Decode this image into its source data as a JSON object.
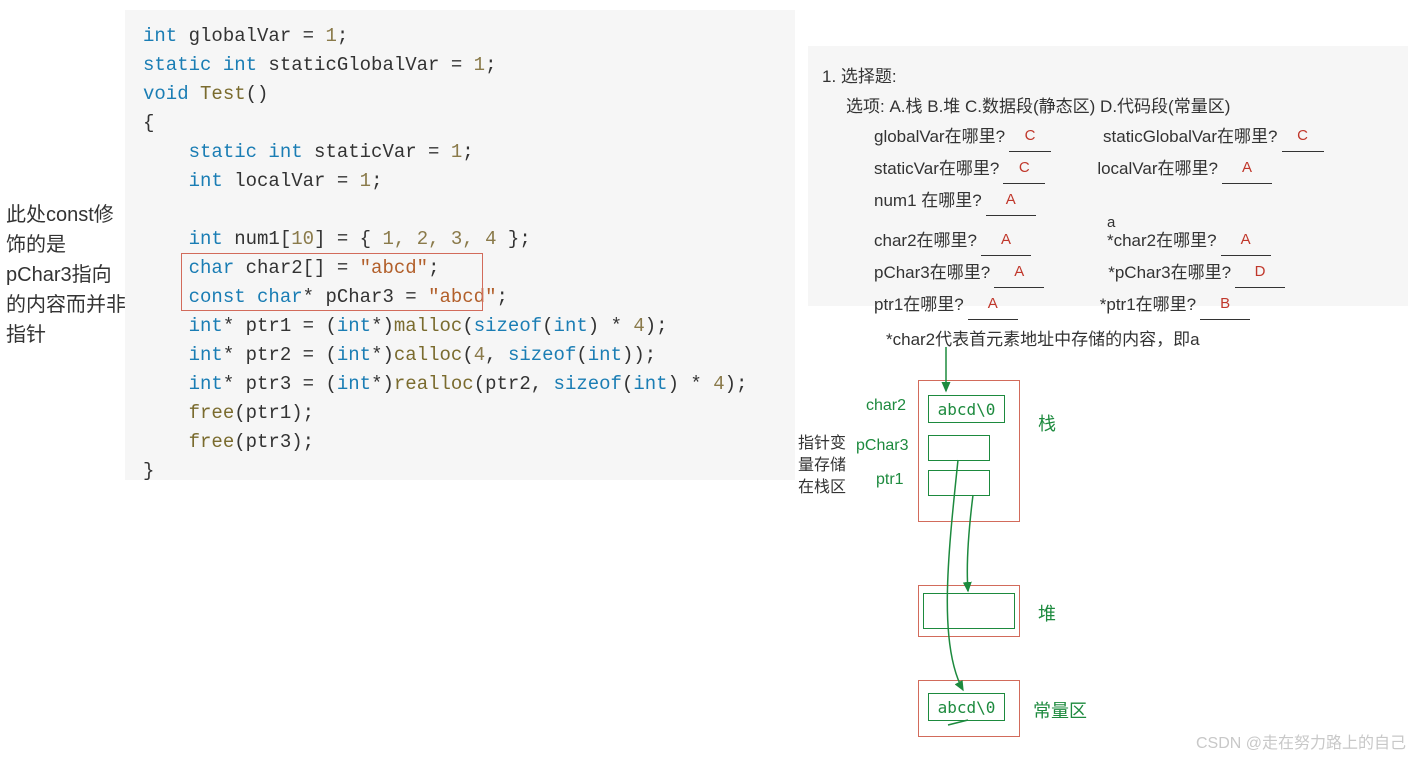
{
  "annotation": "此处const修饰的是pChar3指向的内容而并非指针",
  "code": {
    "l1_kw1": "int",
    "l1_rest": " globalVar = ",
    "l1_num": "1",
    "l1_end": ";",
    "l2_kw1": "static int",
    "l2_rest": " staticGlobalVar = ",
    "l2_num": "1",
    "l2_end": ";",
    "l3_kw1": "void",
    "l3_sp": " ",
    "l3_fn": "Test",
    "l3_end": "()",
    "l4": "{",
    "l5_kw": "static int",
    "l5_rest": " staticVar = ",
    "l5_num": "1",
    "l5_end": ";",
    "l6_kw": "int",
    "l6_rest": " localVar = ",
    "l6_num": "1",
    "l6_end": ";",
    "l8_kw": "int",
    "l8_rest": " num1[",
    "l8_num10": "10",
    "l8_mid": "] = { ",
    "l8_nums": "1, 2, 3, 4",
    "l8_end": " };",
    "l9_kw": "char",
    "l9_rest": " char2[] = ",
    "l9_str": "\"abcd\"",
    "l9_end": ";",
    "l10_kw": "const char",
    "l10_rest": "* pChar3 = ",
    "l10_str": "\"abcd\"",
    "l10_end": ";",
    "l11_kw": "int",
    "l11_a": "* ptr1 = (",
    "l11_kw2": "int",
    "l11_b": "*)",
    "l11_fn": "malloc",
    "l11_c": "(",
    "l11_kw3": "sizeof",
    "l11_d": "(",
    "l11_kw4": "int",
    "l11_e": ") * ",
    "l11_num": "4",
    "l11_f": ");",
    "l12_kw": "int",
    "l12_a": "* ptr2 = (",
    "l12_kw2": "int",
    "l12_b": "*)",
    "l12_fn": "calloc",
    "l12_c": "(",
    "l12_num": "4",
    "l12_d": ", ",
    "l12_kw3": "sizeof",
    "l12_e": "(",
    "l12_kw4": "int",
    "l12_f": "));",
    "l13_kw": "int",
    "l13_a": "* ptr3 = (",
    "l13_kw2": "int",
    "l13_b": "*)",
    "l13_fn": "realloc",
    "l13_c": "(ptr2, ",
    "l13_kw3": "sizeof",
    "l13_d": "(",
    "l13_kw4": "int",
    "l13_e": ") * ",
    "l13_num": "4",
    "l13_f": ");",
    "l14_fn": "free",
    "l14_rest": "(ptr1);",
    "l15_fn": "free",
    "l15_rest": "(ptr3);",
    "l16": "}"
  },
  "quiz": {
    "title": "1.  选择题:",
    "options": "选项:  A.栈    B.堆    C.数据段(静态区)    D.代码段(常量区)",
    "q_globalVar": "globalVar在哪里?",
    "a_globalVar": "C",
    "q_staticGlobalVar": "staticGlobalVar在哪里?",
    "a_staticGlobalVar": "C",
    "q_staticVar": "staticVar在哪里?",
    "a_staticVar": "C",
    "q_localVar": "localVar在哪里?",
    "a_localVar": "A",
    "q_num1": "num1  在哪里?",
    "a_num1": "A",
    "sup_a": "a",
    "q_char2": "char2在哪里?",
    "a_char2": "A",
    "q_star_char2": "*char2在哪里?",
    "a_star_char2": "A",
    "q_pChar3": "pChar3在哪里?",
    "a_pChar3": "A",
    "q_star_pChar3": "*pChar3在哪里?",
    "a_star_pChar3": "D",
    "q_ptr1": "ptr1在哪里?",
    "a_ptr1": "A",
    "q_star_ptr1": "*ptr1在哪里?",
    "a_star_ptr1": "B"
  },
  "diagram": {
    "top_note": "*char2代表首元素地址中存储的内容，即a",
    "ptr_note_l1": "指针变",
    "ptr_note_l2": "量存储",
    "ptr_note_l3": "在栈区",
    "lbl_char2": "char2",
    "lbl_pChar3": "pChar3",
    "lbl_ptr1": "ptr1",
    "region_stack": "栈",
    "region_heap": "堆",
    "region_const": "常量区",
    "box_abcd": "abcd\\0"
  },
  "watermark": "CSDN @走在努力路上的自己"
}
